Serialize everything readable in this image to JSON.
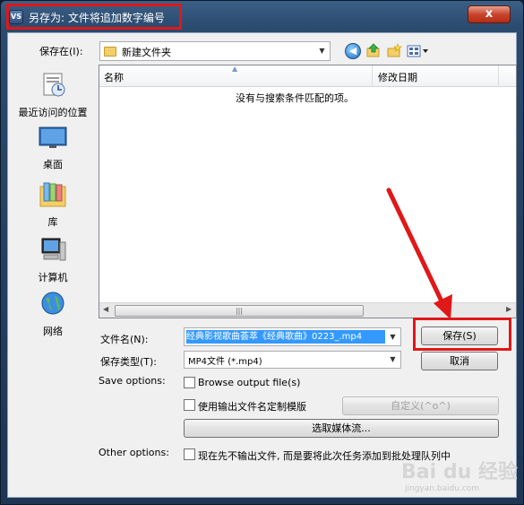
{
  "window": {
    "title": "另存为: 文件将追加数字编号",
    "app_icon_text": "VS",
    "close_glyph": "x"
  },
  "save_in": {
    "label": "保存在(I):",
    "folder_name": "新建文件夹"
  },
  "places": [
    {
      "label": "最近访问的位置",
      "icon": "recent-places-icon"
    },
    {
      "label": "桌面",
      "icon": "desktop-icon"
    },
    {
      "label": "库",
      "icon": "libraries-icon"
    },
    {
      "label": "计算机",
      "icon": "computer-icon"
    },
    {
      "label": "网络",
      "icon": "network-icon"
    }
  ],
  "file_list": {
    "columns": [
      "名称",
      "修改日期"
    ],
    "empty_message": "没有与搜索条件匹配的项。"
  },
  "filename": {
    "label": "文件名(N):",
    "value": "经典影视歌曲荟萃《经典歌曲》0223_.mp4"
  },
  "filetype": {
    "label": "保存类型(T):",
    "value": "MP4文件 (*.mp4)"
  },
  "buttons": {
    "save": "保存(S)",
    "cancel": "取消",
    "customize": "自定义(^o^)",
    "select_streams": "选取媒体流..."
  },
  "save_options": {
    "label": "Save options:",
    "browse_output": "Browse output file(s)",
    "use_template": "使用输出文件名定制模版"
  },
  "other_options": {
    "label": "Other options:",
    "batch_text": "现在先不输出文件, 而是要将此次任务添加到批处理队列中"
  },
  "watermark": {
    "brand": "Bai du 经验",
    "url": "jingyan.baidu.com"
  },
  "colors": {
    "highlight": "#e01818",
    "selection": "#3399ff",
    "title_bar": "#2a4a6e"
  }
}
